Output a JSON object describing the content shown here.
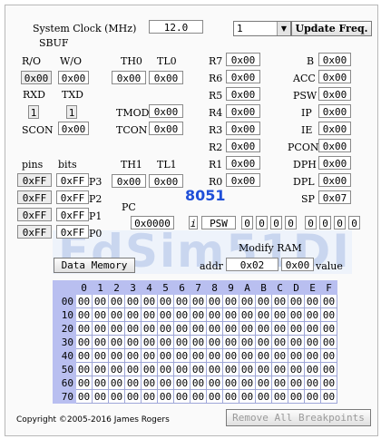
{
  "clock": {
    "label": "System Clock (MHz)",
    "value": "12.0"
  },
  "update_freq": {
    "selected": "1",
    "button_label": "Update Freq."
  },
  "sbuf": {
    "title": "SBUF",
    "ro_label": "R/O",
    "wo_label": "W/O",
    "ro_value": "0x00",
    "wo_value": "0x00",
    "rxd_label": "RXD",
    "txd_label": "TXD",
    "rxd_value": "1",
    "txd_value": "1",
    "scon_label": "SCON",
    "scon_value": "0x00"
  },
  "timers": {
    "th0_label": "TH0",
    "tl0_label": "TL0",
    "th0": "0x00",
    "tl0": "0x00",
    "tmod_label": "TMOD",
    "tmod": "0x00",
    "tcon_label": "TCON",
    "tcon": "0x00",
    "th1_label": "TH1",
    "tl1_label": "TL1",
    "th1": "0x00",
    "tl1": "0x00"
  },
  "regs": [
    {
      "name": "R7",
      "value": "0x00"
    },
    {
      "name": "R6",
      "value": "0x00"
    },
    {
      "name": "R5",
      "value": "0x00"
    },
    {
      "name": "R4",
      "value": "0x00"
    },
    {
      "name": "R3",
      "value": "0x00"
    },
    {
      "name": "R2",
      "value": "0x00"
    },
    {
      "name": "R1",
      "value": "0x00"
    },
    {
      "name": "R0",
      "value": "0x00"
    }
  ],
  "sfr": [
    {
      "name": "B",
      "value": "0x00"
    },
    {
      "name": "ACC",
      "value": "0x00"
    },
    {
      "name": "PSW",
      "value": "0x00"
    },
    {
      "name": "IP",
      "value": "0x00"
    },
    {
      "name": "IE",
      "value": "0x00"
    },
    {
      "name": "PCON",
      "value": "0x00"
    },
    {
      "name": "DPH",
      "value": "0x00"
    },
    {
      "name": "DPL",
      "value": "0x00"
    },
    {
      "name": "SP",
      "value": "0x07"
    }
  ],
  "ports": {
    "pins_label": "pins",
    "bits_label": "bits",
    "rows": [
      {
        "pins": "0xFF",
        "bits": "0xFF",
        "name": "P3"
      },
      {
        "pins": "0xFF",
        "bits": "0xFF",
        "name": "P2"
      },
      {
        "pins": "0xFF",
        "bits": "0xFF",
        "name": "P1"
      },
      {
        "pins": "0xFF",
        "bits": "0xFF",
        "name": "P0"
      }
    ]
  },
  "chip_label": "8051",
  "pc": {
    "label": "PC",
    "value": "0x0000"
  },
  "psw": {
    "info_label": "i",
    "label": "PSW",
    "bits": [
      "0",
      "0",
      "0",
      "0",
      "0",
      "0",
      "0",
      "0"
    ]
  },
  "modify_ram": {
    "title": "Modify RAM",
    "addr_label": "addr",
    "addr_value": "0x02",
    "value_value": "0x00",
    "value_label": "value"
  },
  "data_memory_button": "Data Memory",
  "memory": {
    "columns": [
      "0",
      "1",
      "2",
      "3",
      "4",
      "5",
      "6",
      "7",
      "8",
      "9",
      "A",
      "B",
      "C",
      "D",
      "E",
      "F"
    ],
    "rows": [
      {
        "addr": "00",
        "cells": [
          "00",
          "00",
          "00",
          "00",
          "00",
          "00",
          "00",
          "00",
          "00",
          "00",
          "00",
          "00",
          "00",
          "00",
          "00",
          "00"
        ]
      },
      {
        "addr": "10",
        "cells": [
          "00",
          "00",
          "00",
          "00",
          "00",
          "00",
          "00",
          "00",
          "00",
          "00",
          "00",
          "00",
          "00",
          "00",
          "00",
          "00"
        ]
      },
      {
        "addr": "20",
        "cells": [
          "00",
          "00",
          "00",
          "00",
          "00",
          "00",
          "00",
          "00",
          "00",
          "00",
          "00",
          "00",
          "00",
          "00",
          "00",
          "00"
        ]
      },
      {
        "addr": "30",
        "cells": [
          "00",
          "00",
          "00",
          "00",
          "00",
          "00",
          "00",
          "00",
          "00",
          "00",
          "00",
          "00",
          "00",
          "00",
          "00",
          "00"
        ]
      },
      {
        "addr": "40",
        "cells": [
          "00",
          "00",
          "00",
          "00",
          "00",
          "00",
          "00",
          "00",
          "00",
          "00",
          "00",
          "00",
          "00",
          "00",
          "00",
          "00"
        ]
      },
      {
        "addr": "50",
        "cells": [
          "00",
          "00",
          "00",
          "00",
          "00",
          "00",
          "00",
          "00",
          "00",
          "00",
          "00",
          "00",
          "00",
          "00",
          "00",
          "00"
        ]
      },
      {
        "addr": "60",
        "cells": [
          "00",
          "00",
          "00",
          "00",
          "00",
          "00",
          "00",
          "00",
          "00",
          "00",
          "00",
          "00",
          "00",
          "00",
          "00",
          "00"
        ]
      },
      {
        "addr": "70",
        "cells": [
          "00",
          "00",
          "00",
          "00",
          "00",
          "00",
          "00",
          "00",
          "00",
          "00",
          "00",
          "00",
          "00",
          "00",
          "00",
          "00"
        ]
      }
    ]
  },
  "watermark": "EdSim51DI",
  "copyright": "Copyright ©2005-2016 James Rogers",
  "remove_breakpoints_button": "Remove All Breakpoints",
  "colors": {
    "chip_label": "#1f4fd8",
    "memory_header": "#b9bff0",
    "watermark": "#c9d6ef"
  }
}
